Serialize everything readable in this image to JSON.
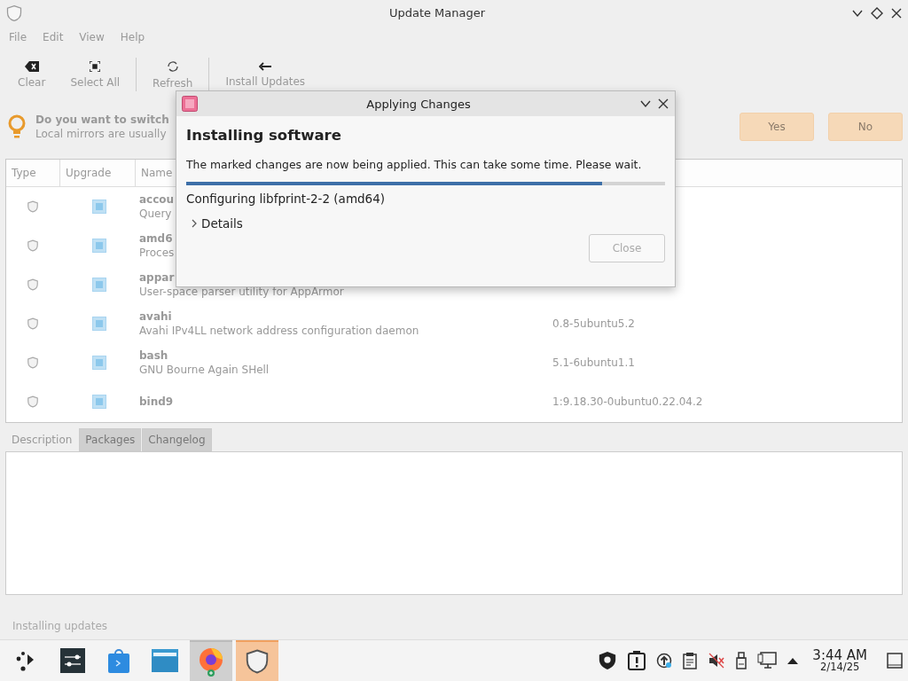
{
  "window": {
    "title": "Update Manager"
  },
  "menu": [
    "File",
    "Edit",
    "View",
    "Help"
  ],
  "toolbar": [
    {
      "kind": "clear",
      "label": "Clear"
    },
    {
      "kind": "select-all",
      "label": "Select All"
    },
    {
      "kind": "refresh",
      "label": "Refresh"
    },
    {
      "kind": "install",
      "label": "Install Updates"
    }
  ],
  "banner": {
    "title": "Do you want to switch",
    "text": "Local mirrors are usually",
    "buttons": [
      "Yes",
      "No"
    ]
  },
  "table": {
    "columns": [
      "Type",
      "Upgrade",
      "Name"
    ],
    "rows": [
      {
        "checked": true,
        "name": "accou",
        "description": "Query"
      },
      {
        "checked": true,
        "name": "amd6",
        "description": "Proces"
      },
      {
        "checked": true,
        "name": "appar",
        "description": "User-space parser utility for AppArmor"
      },
      {
        "checked": true,
        "name": "avahi",
        "description": "Avahi IPv4LL network address configuration daemon",
        "version": "0.8-5ubuntu5.2"
      },
      {
        "checked": true,
        "name": "bash",
        "description": "GNU Bourne Again SHell",
        "version": "5.1-6ubuntu1.1"
      },
      {
        "checked": true,
        "name": "bind9",
        "version": "1:9.18.30-0ubuntu0.22.04.2"
      }
    ]
  },
  "tabs": [
    {
      "label": "Description",
      "selected": true
    },
    {
      "label": "Packages",
      "selected": false
    },
    {
      "label": "Changelog",
      "selected": false
    }
  ],
  "status_bar": "Installing updates",
  "dialog": {
    "title": "Applying Changes",
    "heading": "Installing software",
    "message": "The marked changes are now being applied. This can take some time. Please wait.",
    "progress": {
      "level": 0.868
    },
    "step": "Configuring libfprint-2-2 (amd64)",
    "details": {
      "label": "Details",
      "expanded": false
    },
    "close_button": {
      "label": "Close",
      "disabled": true
    }
  },
  "taskbar": {
    "tasks": [
      {
        "kind": "launcher",
        "selected": false,
        "highlighted": false
      },
      {
        "kind": "settings",
        "selected": false,
        "highlighted": false
      },
      {
        "kind": "store",
        "selected": false,
        "highlighted": false
      },
      {
        "kind": "files",
        "selected": false,
        "highlighted": false
      },
      {
        "kind": "browser",
        "selected": false,
        "highlighted": true
      },
      {
        "kind": "shield",
        "selected": true,
        "highlighted": false
      }
    ],
    "time": "3:44 AM",
    "date": "2/14/25"
  }
}
